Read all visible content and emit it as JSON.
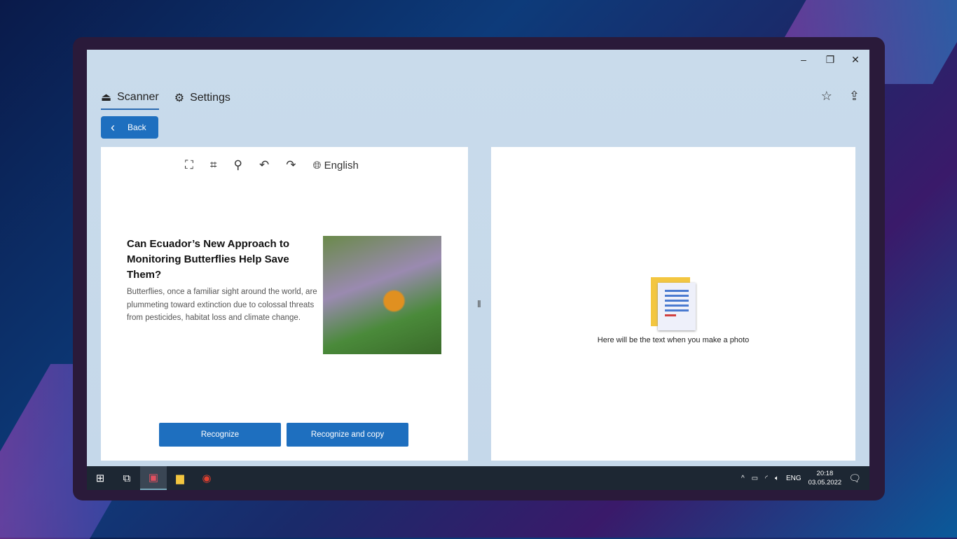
{
  "window": {
    "minimize": "–",
    "maximize": "❐",
    "close": "✕"
  },
  "tabs": [
    {
      "label": "Scanner",
      "icon": "scanner-icon"
    },
    {
      "label": "Settings",
      "icon": "gear-icon"
    }
  ],
  "back_label": "Back",
  "toolbar": {
    "language": "English"
  },
  "article": {
    "title": "Can Ecuador’s New Approach to Monitoring Butterflies Help Save Them?",
    "body": "Butterflies, once a familiar sight around the world, are plummeting toward extinction due to colossal threats from pesticides, habitat loss and climate change."
  },
  "buttons": {
    "recognize": "Recognize",
    "recognize_copy": "Recognize and copy"
  },
  "result": {
    "placeholder": "Here will be the text when you make a photo"
  },
  "taskbar": {
    "lang": "ENG",
    "time": "20:18",
    "date": "03.05.2022"
  }
}
